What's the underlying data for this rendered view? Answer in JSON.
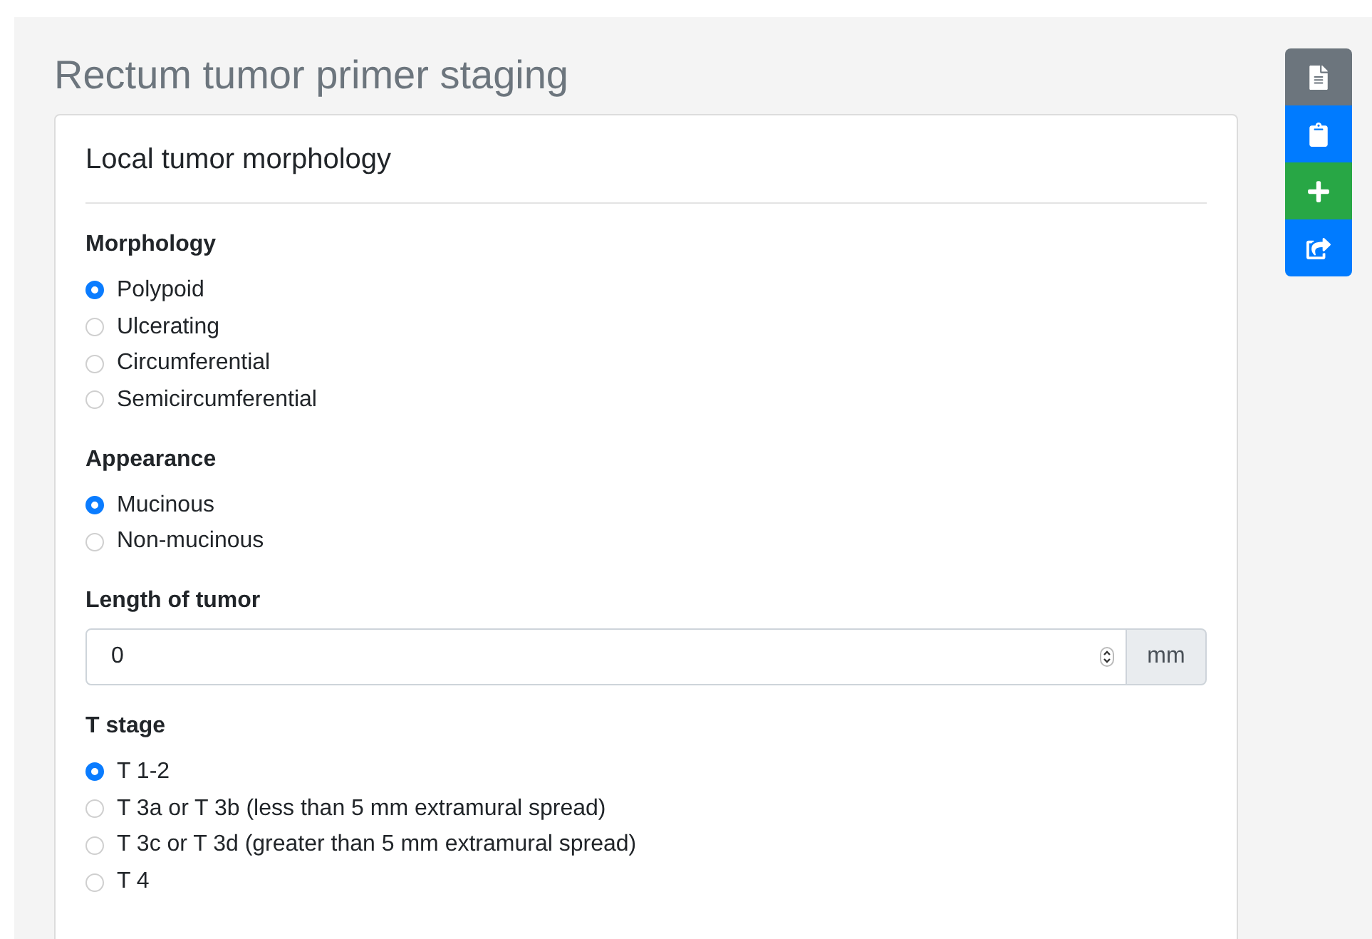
{
  "page": {
    "title": "Rectum tumor primer staging"
  },
  "card": {
    "heading": "Local tumor morphology",
    "fields": [
      {
        "kind": "radio",
        "label": "Morphology",
        "options": [
          {
            "label": "Polypoid",
            "selected": true
          },
          {
            "label": "Ulcerating",
            "selected": false
          },
          {
            "label": "Circumferential",
            "selected": false
          },
          {
            "label": "Semicircumferential",
            "selected": false
          }
        ]
      },
      {
        "kind": "radio",
        "label": "Appearance",
        "options": [
          {
            "label": "Mucinous",
            "selected": true
          },
          {
            "label": "Non-mucinous",
            "selected": false
          }
        ]
      },
      {
        "kind": "number",
        "label": "Length of tumor",
        "value": "0",
        "unit": "mm"
      },
      {
        "kind": "radio",
        "label": "T stage",
        "options": [
          {
            "label": "T 1-2",
            "selected": true
          },
          {
            "label": "T 3a or T 3b (less than 5 mm extramural spread)",
            "selected": false
          },
          {
            "label": "T 3c or T 3d (greater than 5 mm extramural spread)",
            "selected": false
          },
          {
            "label": "T 4",
            "selected": false
          }
        ]
      }
    ]
  },
  "toolbar": [
    {
      "kind": "document",
      "color": "#6c757d"
    },
    {
      "kind": "clipboard",
      "color": "#007bff"
    },
    {
      "kind": "add",
      "color": "#28a745"
    },
    {
      "kind": "share",
      "color": "#007bff"
    }
  ]
}
